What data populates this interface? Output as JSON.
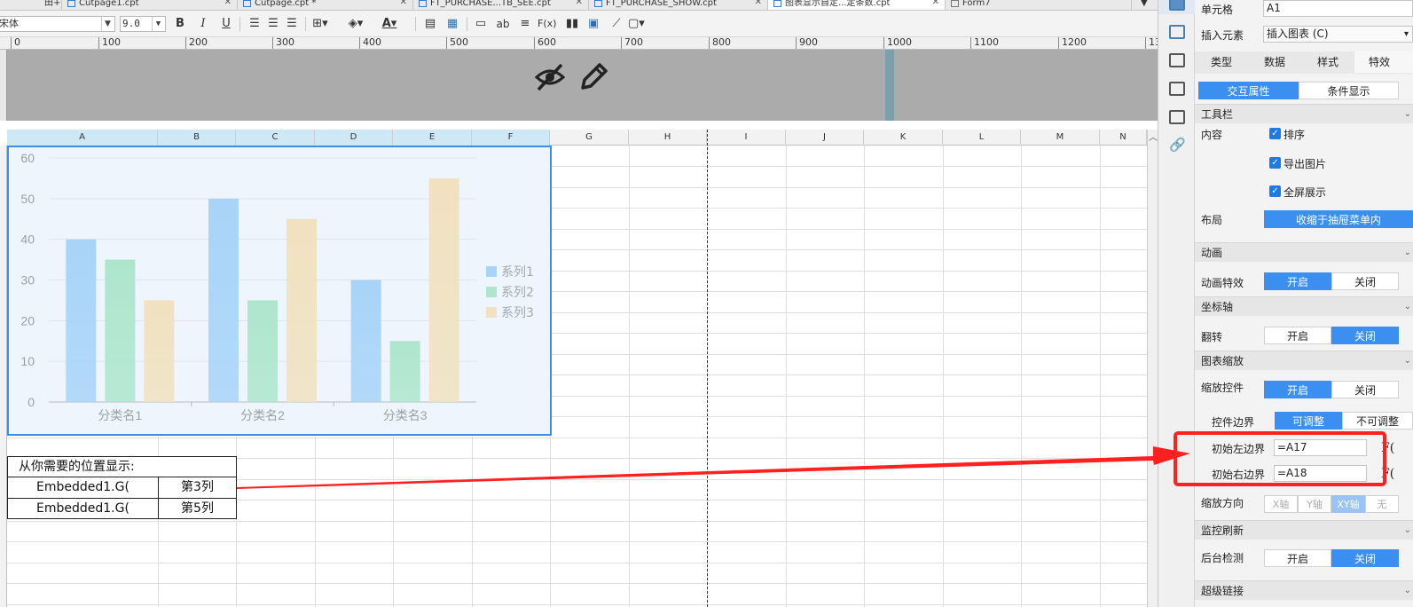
{
  "tabs": [
    {
      "label": "Cutpage1.cpt",
      "x": 75,
      "active": false
    },
    {
      "label": "Cutpage.cpt *",
      "x": 270,
      "active": false
    },
    {
      "label": "FT_PURCHASE...TB_SEE.cpt",
      "x": 468,
      "active": false
    },
    {
      "label": "FT_PURCHASE_SHOW.cpt",
      "x": 668,
      "active": false
    },
    {
      "label": "图表显示自定...定条数.cpt",
      "x": 870,
      "active": true
    },
    {
      "label": "Form7",
      "x": 1072,
      "active": false
    }
  ],
  "toolbar": {
    "font_name": "宋体",
    "font_size": "9.0",
    "bold": "B",
    "italic": "I",
    "underline": "U",
    "text_color": "A",
    "label_ab": "ab",
    "label_fx": "F(x)"
  },
  "ruler": {
    "labels": [
      "0",
      "100",
      "200",
      "300",
      "400",
      "500",
      "600",
      "700",
      "800",
      "900",
      "1000",
      "1100",
      "1200",
      "13"
    ]
  },
  "columns": [
    "A",
    "B",
    "C",
    "D",
    "E",
    "F",
    "G",
    "H",
    "I",
    "J",
    "K",
    "L",
    "M",
    "N"
  ],
  "chart_data": {
    "type": "bar",
    "categories": [
      "分类名1",
      "分类名2",
      "分类名3"
    ],
    "series": [
      {
        "name": "系列1",
        "values": [
          40,
          50,
          30
        ],
        "color": "#a8d4f8"
      },
      {
        "name": "系列2",
        "values": [
          35,
          25,
          15
        ],
        "color": "#aee6cd"
      },
      {
        "name": "系列3",
        "values": [
          25,
          45,
          55
        ],
        "color": "#f0e2c0"
      }
    ],
    "ylim": [
      0,
      60
    ],
    "yticks": [
      "0",
      "10",
      "20",
      "30",
      "40",
      "50",
      "60"
    ],
    "legend_position": "right",
    "grid": true
  },
  "table": {
    "title": "从你需要的位置显示:",
    "rows": [
      {
        "formula": "Embedded1.G(",
        "value": "第3列"
      },
      {
        "formula": "Embedded1.G(",
        "value": "第5列"
      }
    ]
  },
  "panel": {
    "cell_label": "单元格",
    "cell_value": "A1",
    "insert_label": "插入元素",
    "insert_value": "插入图表 (C)",
    "tabs": [
      "类型",
      "数据",
      "样式",
      "特效"
    ],
    "subtabs": [
      "交互属性",
      "条件显示"
    ],
    "sections": {
      "toolbar": "工具栏",
      "animation": "动画",
      "axis": "坐标轴",
      "zoom": "图表缩放",
      "monitor": "监控刷新",
      "link": "超级链接"
    },
    "content_label": "内容",
    "checks": [
      "排序",
      "导出图片",
      "全屏展示"
    ],
    "layout_label": "布局",
    "layout_value": "收缩于抽屉菜单内",
    "anim_effect_label": "动画特效",
    "on": "开启",
    "off": "关闭",
    "flip_label": "翻转",
    "zoom_ctrl_label": "缩放控件",
    "ctrl_border_label": "控件边界",
    "adjustable": "可调整",
    "not_adjustable": "不可调整",
    "init_left_label": "初始左边界",
    "init_left_value": "=A17",
    "init_right_label": "初始右边界",
    "init_right_value": "=A18",
    "fx_short": "F(",
    "zoom_dir_label": "缩放方向",
    "dirs": [
      "X轴",
      "Y轴",
      "XY轴",
      "无"
    ],
    "bg_check_label": "后台检测"
  }
}
